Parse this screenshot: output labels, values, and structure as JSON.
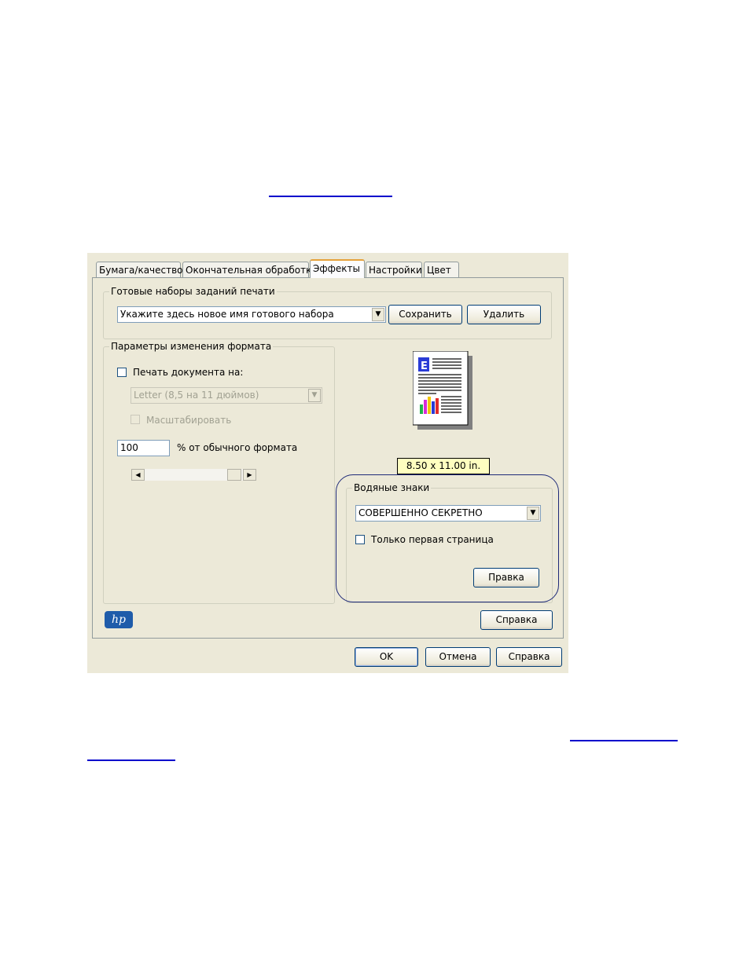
{
  "tabs": [
    {
      "label": "Бумага/качество"
    },
    {
      "label": "Окончательная обработка"
    },
    {
      "label": "Эффекты",
      "active": true
    },
    {
      "label": "Настройки"
    },
    {
      "label": "Цвет"
    }
  ],
  "presets": {
    "legend": "Готовые наборы заданий печати",
    "value": "Укажите здесь новое имя готового набора",
    "save_label": "Сохранить",
    "delete_label": "Удалить"
  },
  "resize": {
    "legend": "Параметры изменения формата",
    "print_on_label": "Печать документа на:",
    "paper_value": "Letter (8,5 на 11 дюймов)",
    "scale_label": "Масштабировать",
    "percent_value": "100",
    "percent_label": "% от обычного формата"
  },
  "preview": {
    "size_label": "8.50 x 11.00 in.",
    "logo_letter": "E"
  },
  "watermarks": {
    "legend": "Водяные знаки",
    "value": "СОВЕРШЕННО СЕКРЕТНО",
    "first_page_label": "Только первая страница",
    "edit_label": "Правка"
  },
  "panel_help_label": "Справка",
  "footer": {
    "ok_label": "OK",
    "cancel_label": "Отмена",
    "help_label": "Справка"
  },
  "logo_text": "hp",
  "colors": {
    "link": "#0000cc",
    "dialog_bg": "#ece9d8",
    "ring": "#1e2a78",
    "badge": "#ffffc0"
  }
}
